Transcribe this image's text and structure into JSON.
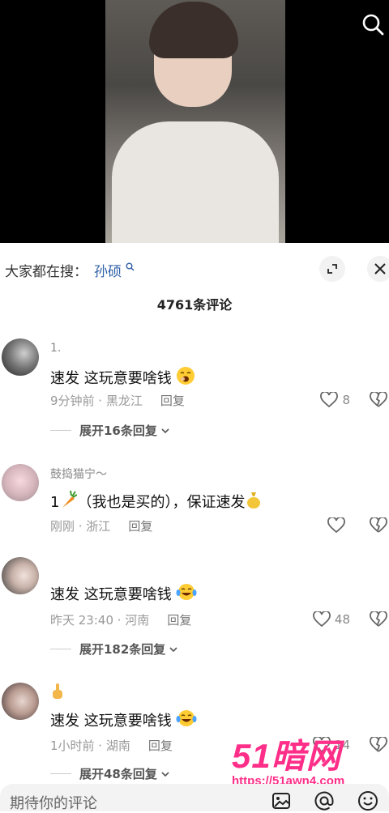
{
  "search": {
    "prefix": "大家都在搜：",
    "term": "孙硕",
    "icon": "search-icon"
  },
  "comment_count": "4761条评论",
  "comments": [
    {
      "name": "1.",
      "text": "速发 这玩意要啥钱",
      "emoji": "yawning-face",
      "time": "9分钟前 · 黑龙江",
      "reply": "回复",
      "likes": "8",
      "expand": "展开16条回复"
    },
    {
      "name": "鼓捣猫宁～",
      "text": "1",
      "text2": "（我也是买的），保证速发",
      "emoji": "carrot",
      "emoji2": "money-bag",
      "time": "刚刚 · 浙江",
      "reply": "回复",
      "likes": ""
    },
    {
      "name": "",
      "text": "速发 这玩意要啥钱",
      "emoji": "tears-of-joy",
      "time": "昨天 23:40 · 河南",
      "reply": "回复",
      "likes": "48",
      "expand": "展开182条回复"
    },
    {
      "name": "",
      "name_emoji": "pointing-up",
      "text": "速发 这玩意要啥钱",
      "emoji": "tears-of-joy",
      "time": "1小时前 · 湖南",
      "reply": "回复",
      "likes": "14",
      "expand": "展开48条回复"
    }
  ],
  "watermark": {
    "logo": "51暗网",
    "url": "https://51awn4.com"
  },
  "input": {
    "placeholder": "期待你的评论",
    "icons": [
      "image-icon",
      "at-icon",
      "emoji-icon"
    ]
  },
  "colors": {
    "link": "#2f5fa7",
    "watermark": "#ff2e88"
  }
}
